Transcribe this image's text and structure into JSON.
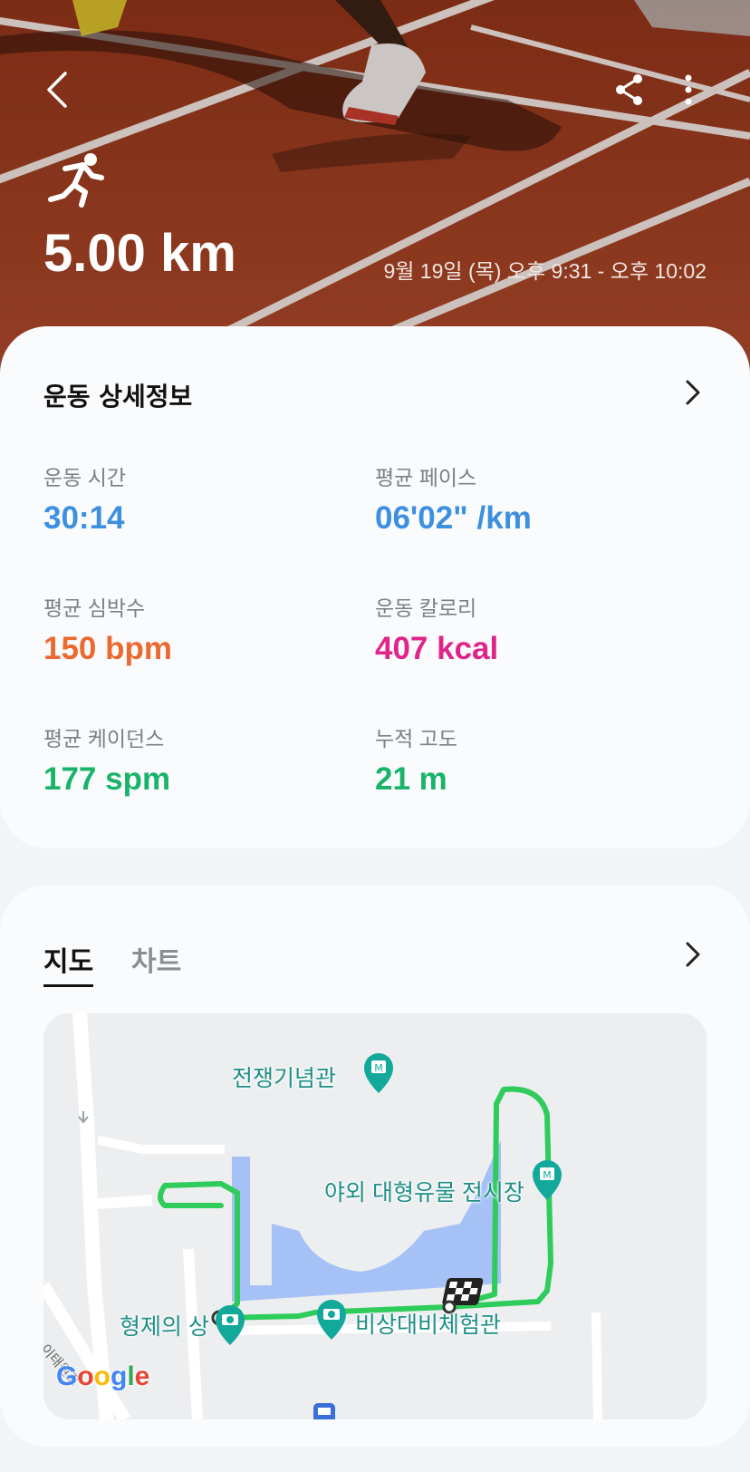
{
  "hero": {
    "distance": "5.00 km",
    "datetime": "9월 19일 (목) 오후 9:31 - 오후 10:02",
    "icons": {
      "back": "back-arrow-icon",
      "share": "share-icon",
      "more": "more-vertical-icon",
      "activity": "running-icon"
    }
  },
  "details": {
    "title": "운동 상세정보",
    "stats": [
      {
        "label": "운동 시간",
        "value": "30:14",
        "color": "#3d8fe0"
      },
      {
        "label": "평균 페이스",
        "value": "06'02\" /km",
        "color": "#3d8fe0"
      },
      {
        "label": "평균 심박수",
        "value": "150 bpm",
        "color": "#ea6a2f"
      },
      {
        "label": "운동 칼로리",
        "value": "407 kcal",
        "color": "#e0258a"
      },
      {
        "label": "평균 케이던스",
        "value": "177 spm",
        "color": "#19b46a"
      },
      {
        "label": "누적 고도",
        "value": "21 m",
        "color": "#19b46a"
      }
    ]
  },
  "map_section": {
    "tabs": [
      {
        "label": "지도",
        "active": true
      },
      {
        "label": "차트",
        "active": false
      }
    ],
    "pois": {
      "war_memorial": "전쟁기념관",
      "outdoor_exhibit": "야외 대형유물 전시장",
      "brothers_statue": "형제의 상",
      "emergency_hall": "비상대비체험관"
    },
    "road_label": "이태원로",
    "attribution": "Google",
    "route_color": "#2ecc5a"
  }
}
